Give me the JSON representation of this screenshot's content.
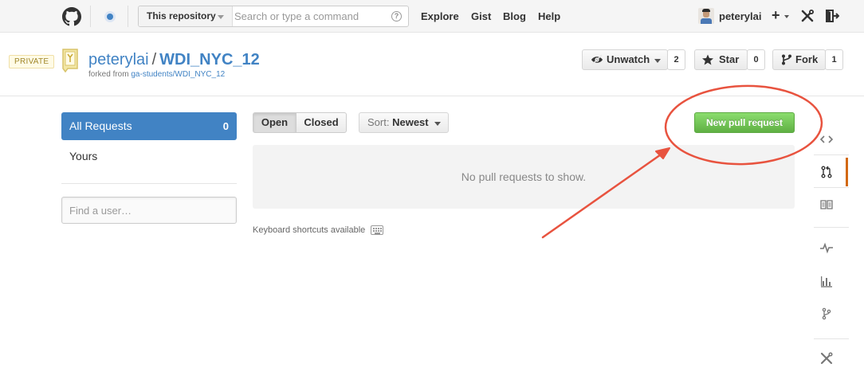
{
  "header": {
    "search_scope": "This repository",
    "search_placeholder": "Search or type a command",
    "help_label": "?",
    "nav": [
      "Explore",
      "Gist",
      "Blog",
      "Help"
    ],
    "username": "peterylai",
    "plus_label": "+"
  },
  "repo": {
    "private_label": "PRIVATE",
    "owner": "peterylai",
    "separator": "/",
    "name": "WDI_NYC_12",
    "forked_prefix": "forked from",
    "forked_source": "ga-students/WDI_NYC_12",
    "watch_label": "Unwatch",
    "watch_count": "2",
    "star_label": "Star",
    "star_count": "0",
    "fork_label": "Fork",
    "fork_count": "1"
  },
  "filters": {
    "all_label": "All Requests",
    "all_count": "0",
    "yours_label": "Yours",
    "user_placeholder": "Find a user…"
  },
  "main": {
    "open_label": "Open",
    "closed_label": "Closed",
    "sort_prefix": "Sort:",
    "sort_value": "Newest",
    "new_pr_label": "New pull request",
    "empty_message": "No pull requests to show.",
    "shortcuts_label": "Keyboard shortcuts available"
  },
  "repo_nav": {
    "selected": "pull-requests",
    "items": [
      "code-icon",
      "pull-request-icon",
      "wiki-icon",
      "pulse-icon",
      "graphs-icon",
      "network-icon",
      "settings-icon"
    ]
  },
  "colors": {
    "link_blue": "#4183c4",
    "selected_filter": "#4183c4",
    "new_pr_green": "#6cc644",
    "annotation_red": "#e8533f",
    "nav_selected_orange": "#d26911"
  }
}
